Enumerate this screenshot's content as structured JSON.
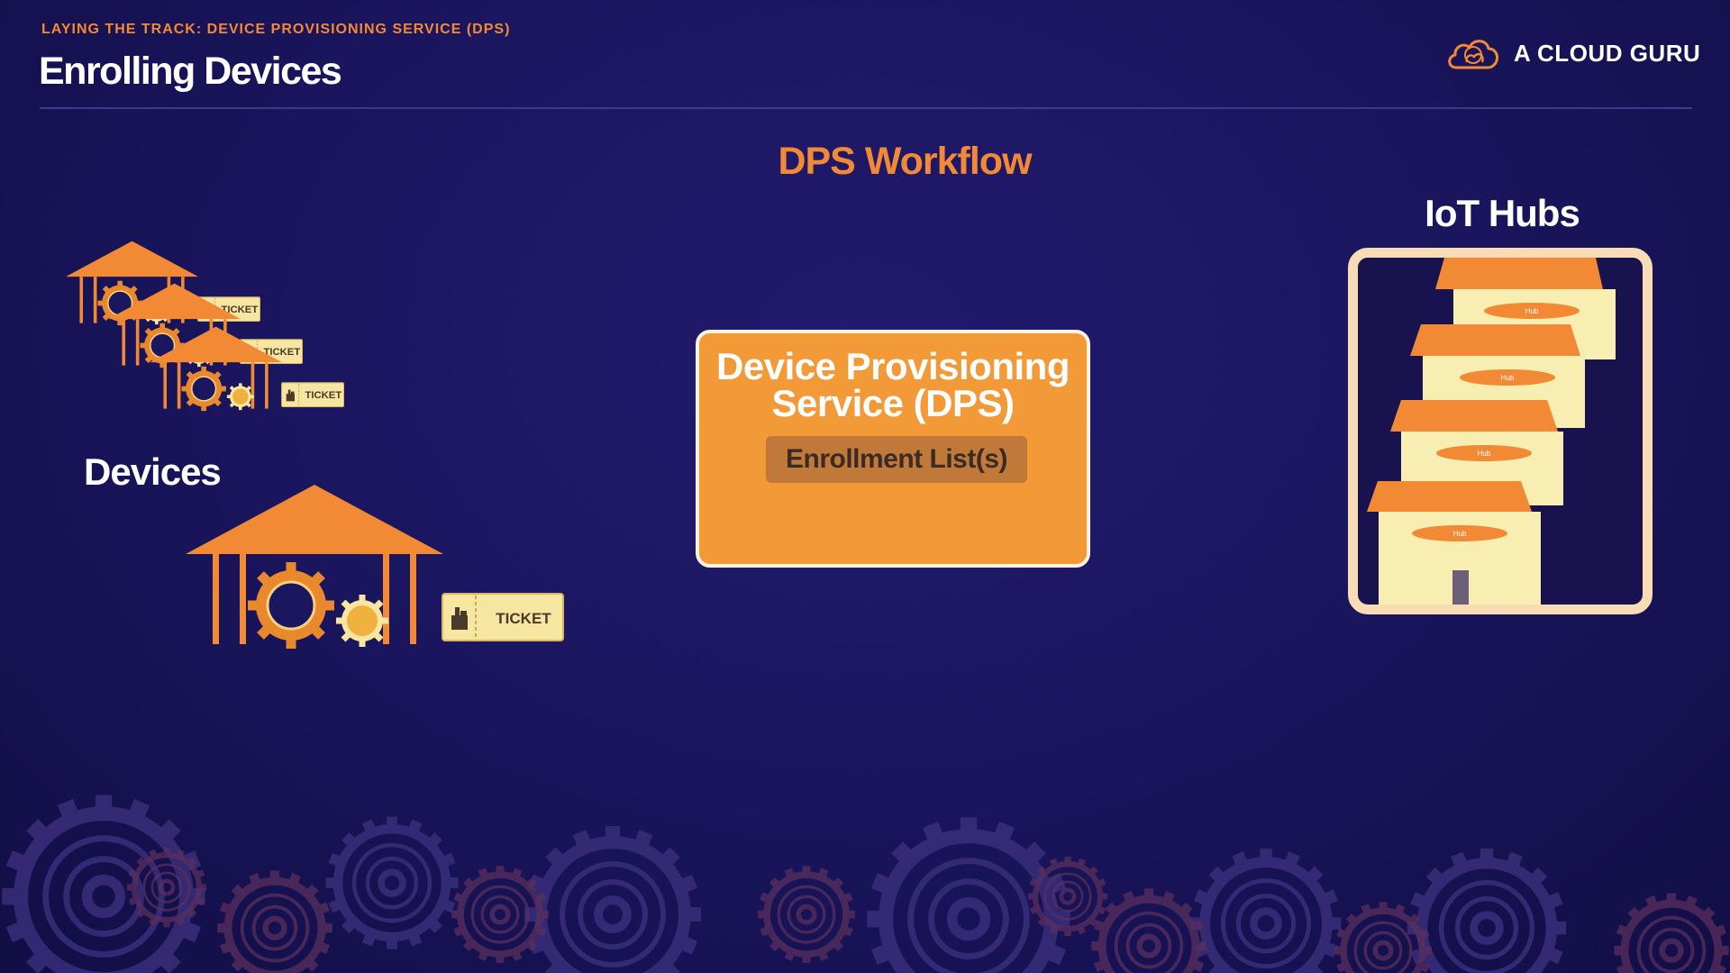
{
  "header": {
    "kicker": "LAYING THE TRACK: DEVICE PROVISIONING SERVICE (DPS)",
    "title": "Enrolling Devices",
    "brand_name": "A CLOUD GURU",
    "brand_icon": "cloud-logo-icon"
  },
  "diagram": {
    "title": "DPS Workflow",
    "devices_label": "Devices",
    "ticket_label": "TICKET",
    "dps_title_line1": "Device Provisioning",
    "dps_title_line2": "Service (DPS)",
    "enrollment_label": "Enrollment List(s)",
    "hubs_label": "IoT Hubs",
    "hub_sign": "Hub",
    "device_icon": "station-gear-icon",
    "hub_icon": "hub-building-icon"
  },
  "colors": {
    "background": "#1b1660",
    "accent_orange": "#f28a35",
    "dps_box": "#f19a37",
    "ticket": "#f7e5a2",
    "hub_building": "#f8eeb2",
    "panel_border": "#f8dcb6"
  }
}
